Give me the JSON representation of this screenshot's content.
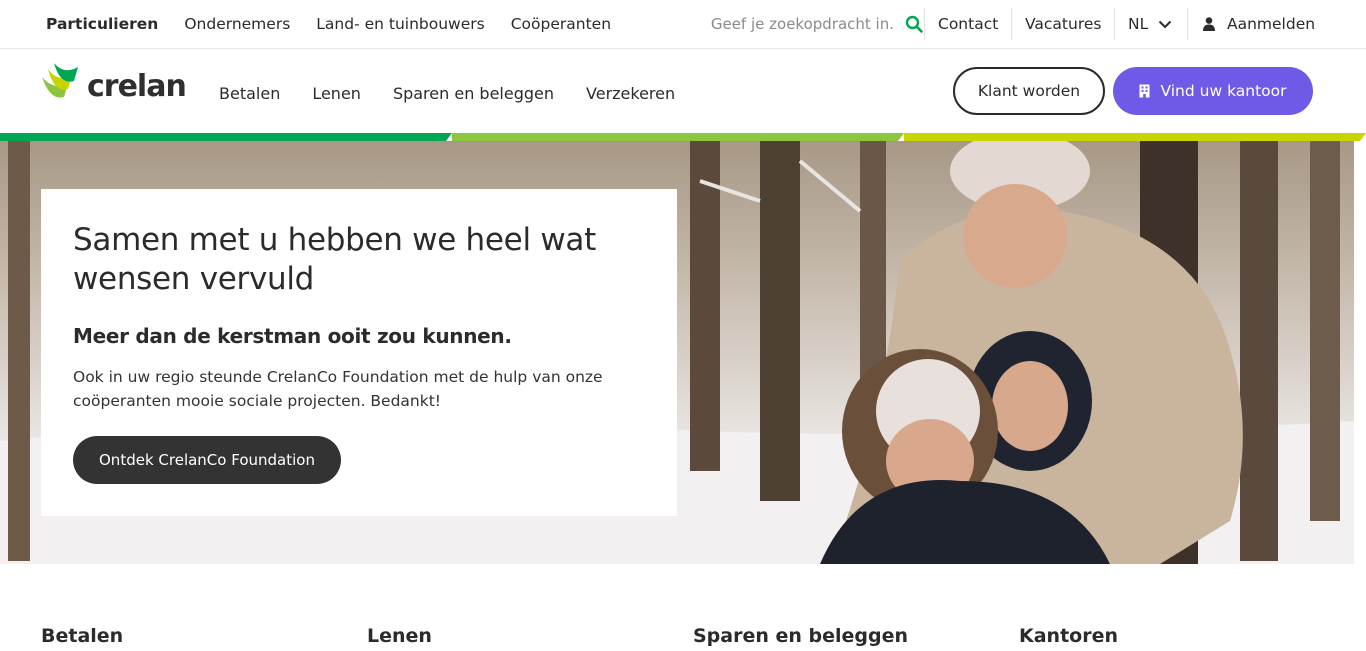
{
  "topbar": {
    "segments": [
      "Particulieren",
      "Ondernemers",
      "Land- en tuinbouwers",
      "Coöperanten"
    ],
    "search_placeholder": "Geef je zoekopdracht in.",
    "contact": "Contact",
    "vacatures": "Vacatures",
    "language": "NL",
    "login": "Aanmelden"
  },
  "logo": {
    "text": "crelan"
  },
  "mainnav": {
    "items": [
      "Betalen",
      "Lenen",
      "Sparen en beleggen",
      "Verzekeren"
    ],
    "klant_worden": "Klant worden",
    "vind_kantoor": "Vind uw kantoor"
  },
  "colors": {
    "accent_purple": "#6d5be8",
    "stripe_green": "#00a651",
    "stripe_lime": "#8cc63f",
    "stripe_yellow": "#c8d400",
    "search_icon": "#00a651"
  },
  "hero": {
    "title": "Samen met u hebben we heel wat wensen vervuld",
    "subtitle": "Meer dan de kerstman ooit zou kunnen.",
    "body": "Ook in uw regio steunde CrelanCo Foundation met de hulp van onze coöperanten mooie sociale projecten. Bedankt!",
    "cta": "Ontdek CrelanCo Foundation"
  },
  "footer": {
    "headings": [
      "Betalen",
      "Lenen",
      "Sparen en beleggen",
      "Kantoren"
    ]
  }
}
